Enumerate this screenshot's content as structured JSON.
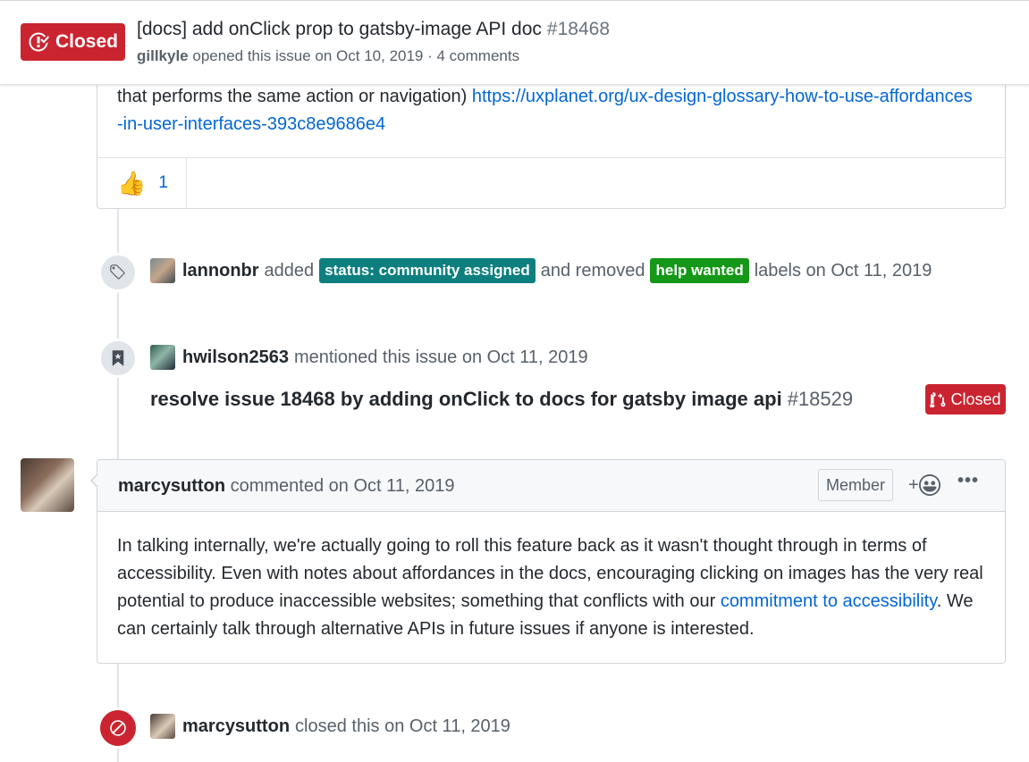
{
  "header": {
    "state_label": "Closed",
    "title": "[docs] add onClick prop to gatsby-image API doc",
    "number": "#18468",
    "author": "gillkyle",
    "meta_rest": "opened this issue on Oct 10, 2019 · 4 comments"
  },
  "top_comment": {
    "text_before": "that performs the same action or navigation)",
    "link": "https://uxplanet.org/ux-design-glossary-how-to-use-affordances-in-user-interfaces-393c8e9686e4",
    "reaction_emoji": "👍",
    "reaction_count": "1"
  },
  "label_event": {
    "actor": "lannonbr",
    "verb_added": "added",
    "added_label": "status: community assigned",
    "added_label_color": "#0e7f7f",
    "verb_removed": "and removed",
    "removed_label": "help wanted",
    "removed_label_color": "#159818",
    "tail": "labels on Oct 11, 2019"
  },
  "mention_event": {
    "actor": "hwilson2563",
    "text": "mentioned this issue on Oct 11, 2019",
    "ref_title": "resolve issue 18468 by adding onClick to docs for gatsby image api",
    "ref_number": "#18529",
    "ref_state": "Closed"
  },
  "comment": {
    "author": "marcysutton",
    "meta": "commented on Oct 11, 2019",
    "role": "Member",
    "react_label": "+",
    "more_label": "•••",
    "body_before": "In talking internally, we're actually going to roll this feature back as it wasn't thought through in terms of accessibility. Even with notes about affordances in the docs, encouraging clicking on images has the very real potential to produce inaccessible websites; something that conflicts with our ",
    "body_link": "commitment to accessibility",
    "body_after": ". We can certainly talk through alternative APIs in future issues if anyone is interested."
  },
  "close_event": {
    "actor": "marcysutton",
    "text": "closed this on Oct 11, 2019"
  },
  "colors": {
    "closed_red": "#cb2431",
    "link_blue": "#0366d6"
  }
}
